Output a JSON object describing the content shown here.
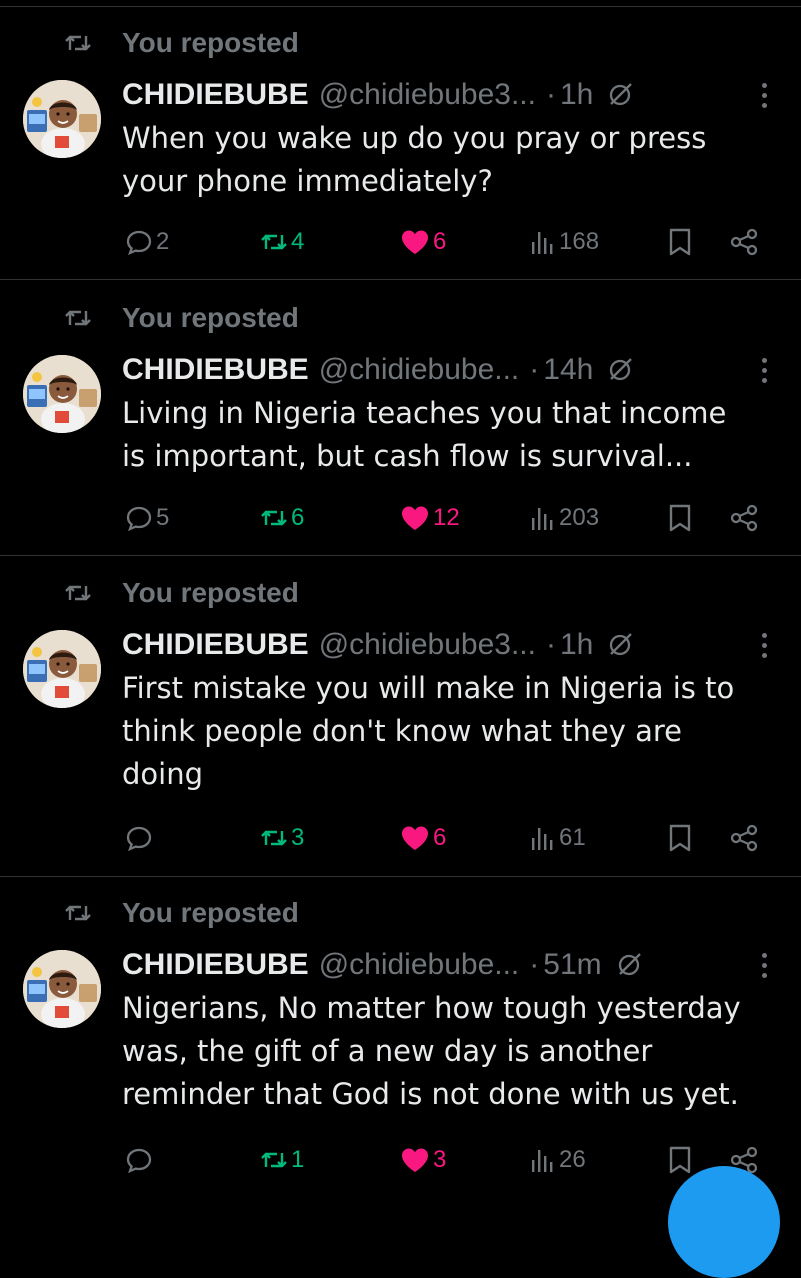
{
  "colors": {
    "repost_green": "#00ba7c",
    "like_pink": "#f91880",
    "muted": "#71767b",
    "text": "#e7e9ea",
    "accent_blue": "#1d9bf0"
  },
  "posts": [
    {
      "repost_label": "You reposted",
      "name": "CHIDIEBUBE",
      "handle": "@chidiebube3...",
      "dot": "·",
      "time": "1h",
      "text": "When you wake up do you pray or press\nyour phone immediately?",
      "replies": "2",
      "reposts": "4",
      "likes": "6",
      "views": "168"
    },
    {
      "repost_label": "You reposted",
      "name": "CHIDIEBUBE",
      "handle": "@chidiebube...",
      "dot": "·",
      "time": "14h",
      "text": "Living in Nigeria teaches you that income\nis important, but cash flow is survival...",
      "replies": "5",
      "reposts": "6",
      "likes": "12",
      "views": "203"
    },
    {
      "repost_label": "You reposted",
      "name": "CHIDIEBUBE",
      "handle": "@chidiebube3...",
      "dot": "·",
      "time": "1h",
      "text": "First mistake you will make in Nigeria is to\nthink people don't know what they are\ndoing",
      "replies": "",
      "reposts": "3",
      "likes": "6",
      "views": "61"
    },
    {
      "repost_label": "You reposted",
      "name": "CHIDIEBUBE",
      "handle": "@chidiebube...",
      "dot": "·",
      "time": "51m",
      "text": "Nigerians, No matter how tough yesterday\nwas, the gift of a new day is another\nreminder that God is not done with us yet.",
      "replies": "",
      "reposts": "1",
      "likes": "3",
      "views": "26"
    }
  ],
  "icons": {
    "repost": "repost-icon",
    "reply": "reply-icon",
    "like": "heart-icon",
    "views": "views-icon",
    "bookmark": "bookmark-icon",
    "share": "share-icon",
    "more": "more-icon",
    "hide": "hide-icon",
    "compose": "compose-button"
  }
}
